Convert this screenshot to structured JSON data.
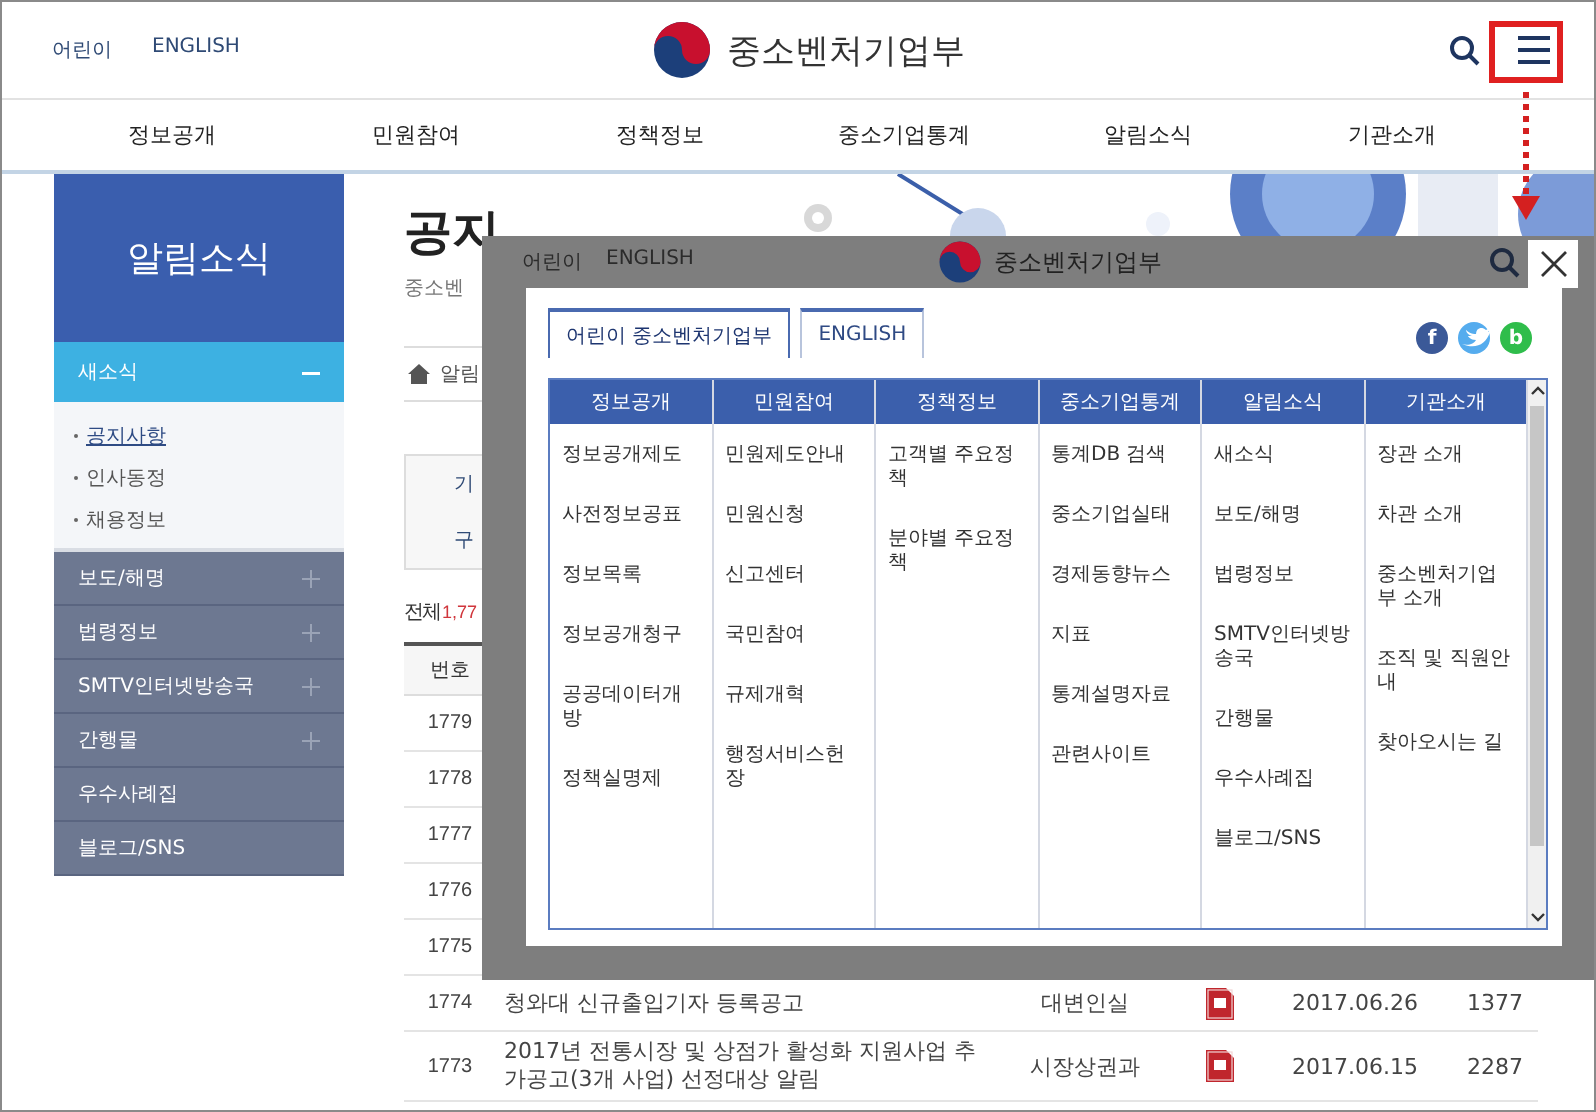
{
  "header": {
    "links": [
      "어린이",
      "ENGLISH"
    ],
    "logo_text": "중소벤처기업부"
  },
  "nav": [
    "정보공개",
    "민원참여",
    "정책정보",
    "중소기업통계",
    "알림소식",
    "기관소개"
  ],
  "sidebar": {
    "title": "알림소식",
    "items": [
      {
        "label": "새소식",
        "expandable": true,
        "expanded": true,
        "children": [
          {
            "label": "공지사항",
            "selected": true
          },
          {
            "label": "인사동정",
            "selected": false
          },
          {
            "label": "채용정보",
            "selected": false
          }
        ]
      },
      {
        "label": "보도/해명",
        "expandable": true,
        "expanded": false
      },
      {
        "label": "법령정보",
        "expandable": true,
        "expanded": false
      },
      {
        "label": "SMTV인터넷방송국",
        "expandable": true,
        "expanded": false
      },
      {
        "label": "간행물",
        "expandable": true,
        "expanded": false
      },
      {
        "label": "우수사례집",
        "expandable": false,
        "expanded": false
      },
      {
        "label": "블로그/SNS",
        "expandable": false,
        "expanded": false
      }
    ]
  },
  "page": {
    "title": "공지",
    "subtitle": "중소벤",
    "breadcrumb": "알림",
    "search_labels": [
      "기",
      "구"
    ],
    "total_label": "전체",
    "total_count": "1,77"
  },
  "table": {
    "columns": [
      "번호"
    ],
    "rows": [
      {
        "number": "1779"
      },
      {
        "number": "1778"
      },
      {
        "number": "1777"
      },
      {
        "number": "1776"
      },
      {
        "number": "1775"
      },
      {
        "number": "1774",
        "title": "청와대 신규출입기자 등록공고",
        "department": "대변인실",
        "attachment": true,
        "date": "2017.06.26",
        "views": "1377"
      },
      {
        "number": "1773",
        "title": "2017년 전통시장 및 상점가 활성화 지원사업 추가공고(3개 사업) 선정대상 알림",
        "department": "시장상권과",
        "attachment": true,
        "date": "2017.06.15",
        "views": "2287"
      }
    ]
  },
  "menu_overlay": {
    "header": {
      "links": [
        "어린이",
        "ENGLISH"
      ],
      "logo_text": "중소벤처기업부"
    },
    "tabs": [
      {
        "label": "어린이 중소벤처기업부",
        "selected": true
      },
      {
        "label": "ENGLISH",
        "selected": false
      }
    ],
    "social": [
      {
        "kind": "facebook",
        "letter": "f"
      },
      {
        "kind": "twitter"
      },
      {
        "kind": "band",
        "letter": "b"
      }
    ],
    "columns": [
      {
        "title": "정보공개",
        "sections": [
          "정보공개제도",
          "사전정보공표",
          "정보목록",
          "정보공개청구",
          "공공데이터개방",
          "정책실명제"
        ]
      },
      {
        "title": "민원참여",
        "sections": [
          "민원제도안내",
          "민원신청",
          "신고센터",
          "국민참여",
          "규제개혁",
          "행정서비스헌장"
        ]
      },
      {
        "title": "정책정보",
        "sections": [
          "고객별 주요정책",
          "분야별 주요정책"
        ]
      },
      {
        "title": "중소기업통계",
        "sections": [
          "통계DB 검색",
          "중소기업실태",
          "경제동향뉴스",
          "지표",
          "통계설명자료",
          "관련사이트"
        ]
      },
      {
        "title": "알림소식",
        "sections": [
          "새소식",
          "보도/해명",
          "법령정보",
          "SMTV인터넷방송국",
          "간행물",
          "우수사례집",
          "블로그/SNS"
        ]
      },
      {
        "title": "기관소개",
        "sections": [
          "장관 소개",
          "차관 소개",
          "중소벤처기업부 소개",
          "조직 및 직원안내",
          "찾아오시는 길"
        ]
      }
    ]
  }
}
